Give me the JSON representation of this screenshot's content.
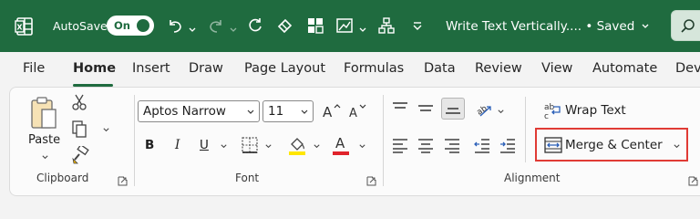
{
  "titlebar": {
    "autosave_label": "AutoSave",
    "toggle_label": "On",
    "doc_title": "Write Text Vertically.... • Saved",
    "accent": "#1f6b3f"
  },
  "tabs": [
    "File",
    "Home",
    "Insert",
    "Draw",
    "Page Layout",
    "Formulas",
    "Data",
    "Review",
    "View",
    "Automate",
    "Dev"
  ],
  "active_tab": "Home",
  "clipboard": {
    "paste_label": "Paste",
    "group_label": "Clipboard"
  },
  "font": {
    "font_name": "Aptos Narrow",
    "font_size": "11",
    "bold": "B",
    "italic": "I",
    "underline": "U",
    "font_color_letter": "A",
    "group_label": "Font"
  },
  "alignment": {
    "wrap_text_label": "Wrap Text",
    "merge_center_label": "Merge & Center",
    "group_label": "Alignment",
    "highlight_color": "#e03b35"
  }
}
